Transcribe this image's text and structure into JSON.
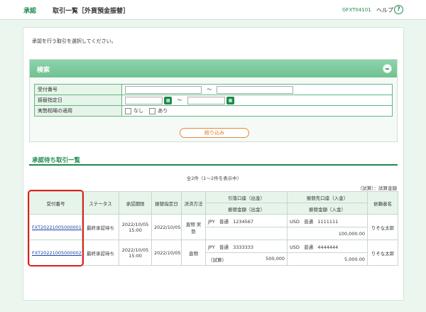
{
  "header": {
    "section": "承認",
    "title": "取引一覧［外貨預金振替］",
    "screen_code": "GFXT04101",
    "help_label": "ヘルプ",
    "help_icon": "?"
  },
  "instruction": "承認を行う取引を選択してください。",
  "search": {
    "title": "検索",
    "fields": {
      "receipt_no_label": "受付番号",
      "transfer_date_label": "振替指定日",
      "actual_rate_label": "実勢相場の適用",
      "tilde": "～",
      "option_none": "なし",
      "option_yes": "あり",
      "calendar_icon": "▦"
    },
    "filter_button": "絞り込み"
  },
  "list": {
    "title": "承認待ち取引一覧",
    "count_text": "全2件（1～2件を表示中）",
    "note": "（試算）：試算金額",
    "headers": {
      "receipt_no": "受付番号",
      "status": "ステータス",
      "approval_deadline": "承認期限",
      "transfer_date": "振替指定日",
      "settlement": "決済方法",
      "from_account": "引落口座（出金）",
      "from_amount": "振替金額（出金）",
      "to_account": "振替先口座（入金）",
      "to_amount": "振替金額（入金）",
      "requester": "依頼者名"
    },
    "rows": [
      {
        "receipt_no": "FXT20221005000001",
        "status": "最終承認待ち",
        "deadline_date": "2022/10/05",
        "deadline_time": "15:00",
        "transfer_date": "2022/10/05",
        "settlement": "直物 実勢",
        "from_ccy": "JPY",
        "from_type": "普通",
        "from_no": "1234567",
        "from_note": "",
        "from_amount": "",
        "to_ccy": "USD",
        "to_type": "普通",
        "to_no": "1111111",
        "to_amount": "100,000.00",
        "requester": "りそな太郎"
      },
      {
        "receipt_no": "FXT20221005000002",
        "status": "最終承認待ち",
        "deadline_date": "2022/10/05",
        "deadline_time": "15:00",
        "transfer_date": "2022/10/05",
        "settlement": "直物",
        "from_ccy": "JPY",
        "from_type": "普通",
        "from_no": "3333333",
        "from_note": "（試算）",
        "from_amount": "500,000",
        "to_ccy": "USD",
        "to_type": "普通",
        "to_no": "4444444",
        "to_amount": "5,000.00",
        "requester": "りそな太郎"
      }
    ]
  }
}
